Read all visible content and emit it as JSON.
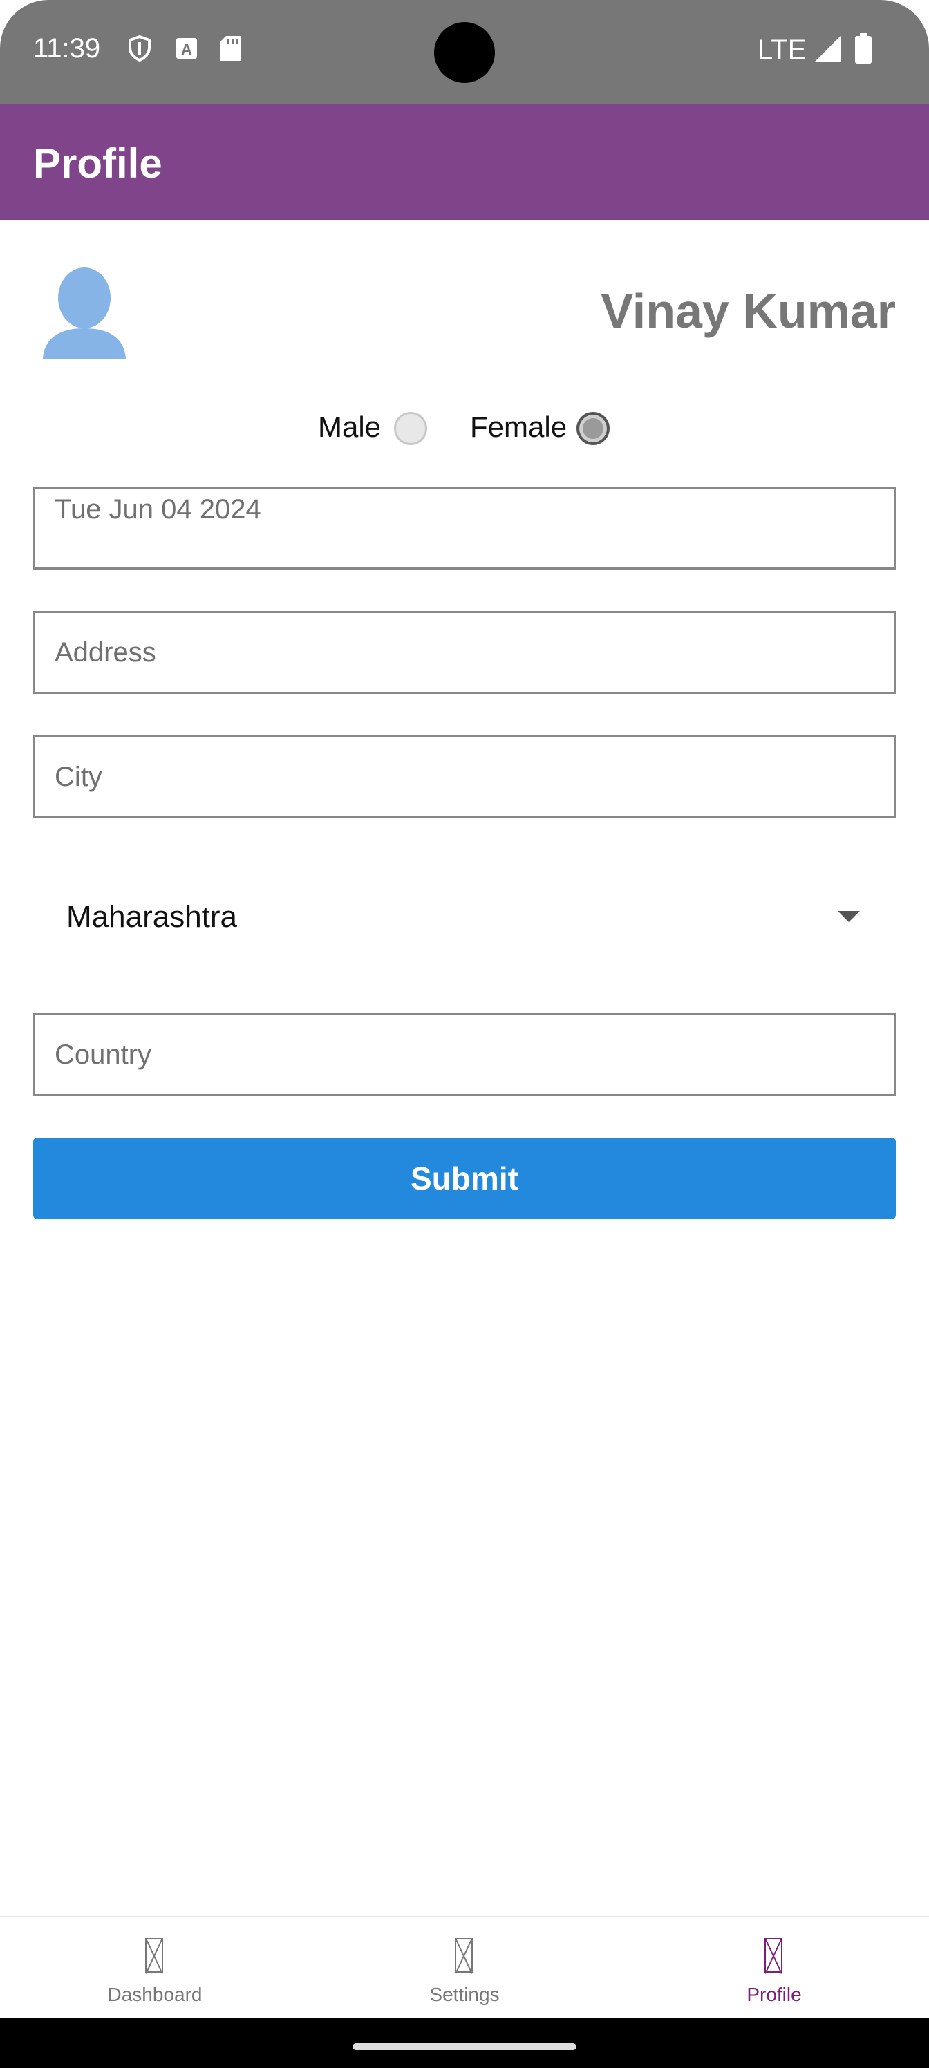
{
  "status_bar": {
    "time": "11:39",
    "network": "LTE",
    "icons": [
      "shield-icon",
      "text-a-icon",
      "sd-card-icon",
      "signal-icon",
      "battery-icon"
    ]
  },
  "app_bar": {
    "title": "Profile"
  },
  "profile": {
    "name": "Vinay Kumar",
    "avatar_icon": "user-silhouette-icon",
    "avatar_color": "#86b4e6"
  },
  "gender": {
    "options": [
      {
        "label": "Male",
        "selected": false
      },
      {
        "label": "Female",
        "selected": true
      }
    ]
  },
  "form": {
    "date_value": "Tue Jun 04 2024",
    "address_placeholder": "Address",
    "city_placeholder": "City",
    "state_selected": "Maharashtra",
    "country_placeholder": "Country",
    "submit_label": "Submit"
  },
  "bottom_nav": {
    "items": [
      {
        "label": "Dashboard",
        "active": false
      },
      {
        "label": "Settings",
        "active": false
      },
      {
        "label": "Profile",
        "active": true
      }
    ]
  },
  "colors": {
    "app_bar": "#7f4489",
    "status_bar": "#777777",
    "submit": "#2289dc",
    "nav_active": "#7b1f7a"
  }
}
